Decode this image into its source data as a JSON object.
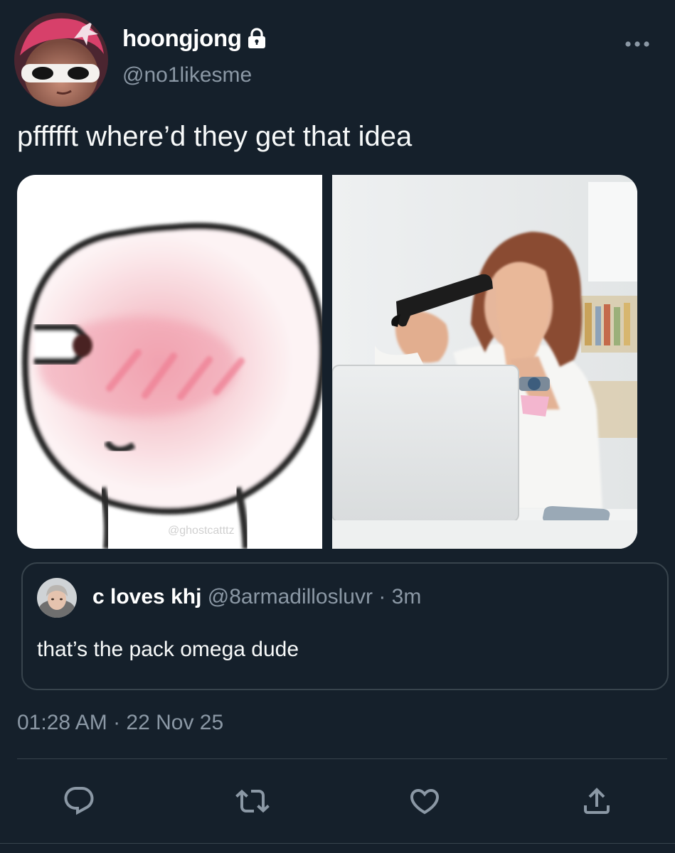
{
  "author": {
    "display_name": "hoongjong",
    "handle": "@no1likesme",
    "protected": true
  },
  "tweet": {
    "text": "pffffft where’d they get that idea",
    "media_count": 2,
    "watermark": "@ghostcatttz"
  },
  "quote": {
    "display_name": "c loves khj",
    "handle": "@8armadillosluvr",
    "separator": "·",
    "time": "3m",
    "text": "that’s the pack omega dude"
  },
  "timestamp": "01:28 AM · 22 Nov 25",
  "actions": [
    "reply-icon",
    "retweet-icon",
    "like-icon",
    "share-icon"
  ],
  "colors": {
    "background": "#15202b",
    "text": "#ffffff",
    "secondary": "#8b98a5",
    "border": "#38444d"
  }
}
